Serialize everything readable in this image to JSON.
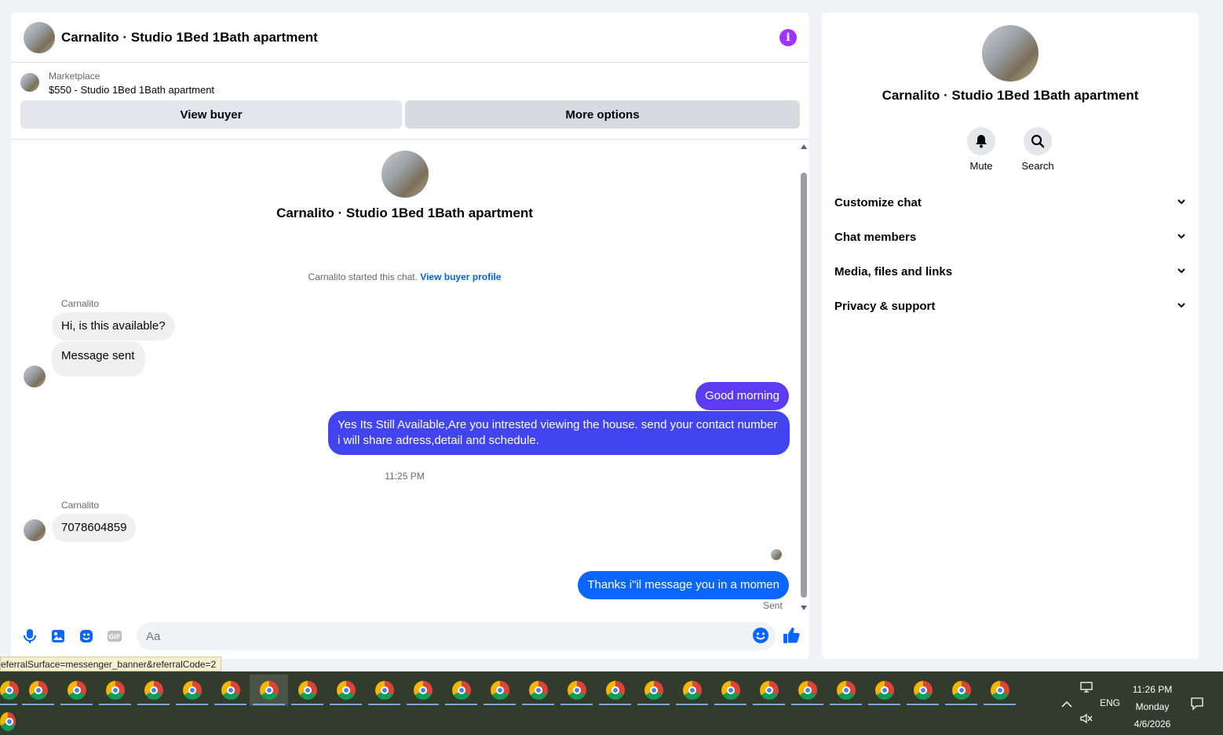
{
  "chat": {
    "title": "Carnalito · Studio 1Bed 1Bath apartment",
    "marketplace_label": "Marketplace",
    "listing": "$550 - Studio 1Bed 1Bath apartment",
    "view_buyer_label": "View buyer",
    "more_options_label": "More options",
    "intro_title": "Carnalito · Studio 1Bed 1Bath apartment",
    "started_text": "Carnalito started this chat.",
    "view_buyer_profile": "View buyer profile",
    "messages": [
      {
        "sender": "Carnalito",
        "text": "Hi, is this available?"
      },
      {
        "text": "Message sent"
      },
      {
        "text": "Good morning"
      },
      {
        "text": "Yes Its Still Available,Are you intrested viewing the house. send your contact number i will share adress,detail and schedule."
      },
      {
        "timestamp": "11:25 PM"
      },
      {
        "sender": "Carnalito",
        "text": "7078604859"
      },
      {
        "text": "Thanks i\"il message you in a momen"
      }
    ],
    "sent_label": "Sent",
    "composer_placeholder": "Aa",
    "colors": {
      "accent_purple": "#5b3cf0",
      "accent_blue": "#0a66ff",
      "info_icon": "#a033ff"
    }
  },
  "info": {
    "title": "Carnalito · Studio 1Bed 1Bath apartment",
    "mute_label": "Mute",
    "search_label": "Search",
    "sections": [
      "Customize chat",
      "Chat members",
      "Media, files and links",
      "Privacy & support"
    ]
  },
  "statusbar": {
    "url": "eferralSurface=messenger_banner&referralCode=2"
  },
  "taskbar": {
    "time": "11:26 PM",
    "day": "Monday",
    "date": "4/6/2026",
    "language": "ENG"
  }
}
